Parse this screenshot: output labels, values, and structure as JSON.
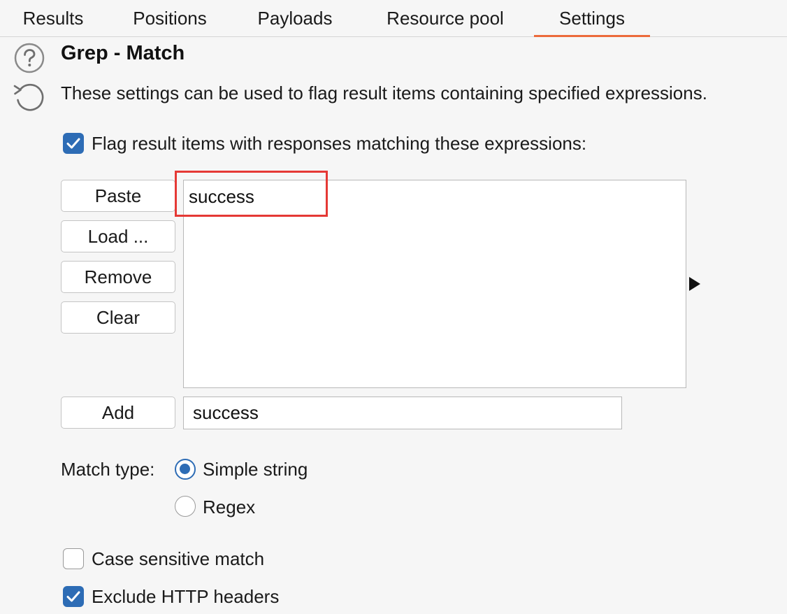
{
  "tabs": [
    {
      "label": "Results"
    },
    {
      "label": "Positions"
    },
    {
      "label": "Payloads"
    },
    {
      "label": "Resource pool"
    },
    {
      "label": "Settings",
      "active": true
    }
  ],
  "section": {
    "title": "Grep - Match",
    "description": "These settings can be used to flag result items containing specified expressions."
  },
  "flag_checkbox": {
    "label": "Flag result items with responses matching these expressions:",
    "checked": true
  },
  "buttons": {
    "paste": "Paste",
    "load": "Load ...",
    "remove": "Remove",
    "clear": "Clear",
    "add": "Add"
  },
  "expressions": [
    "success"
  ],
  "add_input": {
    "value": "success"
  },
  "match_type": {
    "label": "Match type:",
    "options": [
      {
        "label": "Simple string",
        "selected": true
      },
      {
        "label": "Regex",
        "selected": false
      }
    ]
  },
  "case_sensitive": {
    "label": "Case sensitive match",
    "checked": false
  },
  "exclude_headers": {
    "label": "Exclude HTTP headers",
    "checked": true
  },
  "colors": {
    "accent": "#2d6cb5",
    "tab_underline": "#ec6a3b",
    "highlight": "#e53935"
  },
  "icons": {
    "help": "help-circle-icon",
    "reset": "reset-icon",
    "expand": "triangle-right-icon"
  }
}
